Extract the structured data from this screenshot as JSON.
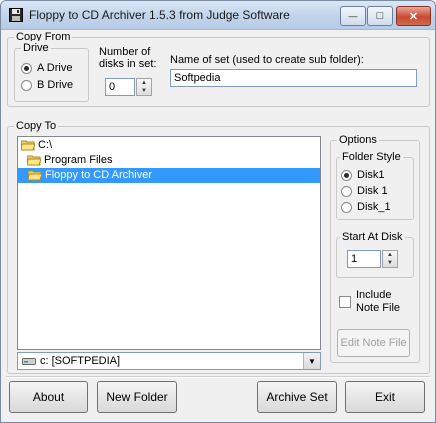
{
  "window": {
    "title": "Floppy to CD Archiver 1.5.3 from Judge Software",
    "minimize_glyph": "—",
    "maximize_glyph": "□",
    "close_glyph": "✕"
  },
  "copy_from": {
    "legend": "Copy From",
    "drive_legend": "Drive",
    "drive_a": "A Drive",
    "drive_b": "B Drive",
    "selected_drive": "A Drive",
    "disks_label_1": "Number of",
    "disks_label_2": "disks in set:",
    "disks_value": "0",
    "set_name_label": "Name of set (used to create sub folder):",
    "set_name_value": "Softpedia"
  },
  "copy_to": {
    "legend": "Copy To",
    "folders": [
      {
        "label": "C:\\",
        "selected": false
      },
      {
        "label": "Program Files",
        "selected": false
      },
      {
        "label": "Floppy to CD Archiver",
        "selected": true
      }
    ],
    "drive_combo": "c: [SOFTPEDIA]"
  },
  "options": {
    "legend": "Options",
    "folder_style_legend": "Folder Style",
    "styles": [
      "Disk1",
      "Disk 1",
      "Disk_1"
    ],
    "selected_style": "Disk1",
    "start_at_legend": "Start At Disk",
    "start_at_value": "1",
    "include_note_1": "Include",
    "include_note_2": "Note File",
    "include_note_checked": false,
    "edit_note_button": "Edit Note File"
  },
  "buttons": {
    "about": "About",
    "new_folder": "New Folder",
    "archive_set": "Archive Set",
    "exit": "Exit"
  },
  "icons": {
    "app": "floppy-disk-icon",
    "folder": "folder-icon",
    "drive": "hard-drive-icon"
  },
  "colors": {
    "selection": "#3399ff",
    "titlebar": "#c3d5ec",
    "close_button": "#c94a32",
    "window_bg": "#f0f0f0"
  }
}
